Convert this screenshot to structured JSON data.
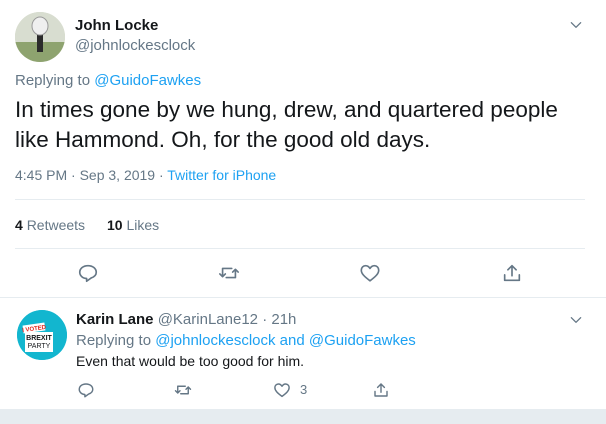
{
  "main_tweet": {
    "author_name": "John Locke",
    "author_handle": "@johnlockesclock",
    "replying_prefix": "Replying to",
    "replying_to": "@GuidoFawkes",
    "text": "In times gone by we hung, drew, and quartered people like Hammond. Oh, for the good old days.",
    "time": "4:45 PM · Sep 3, 2019 ·",
    "source": "Twitter for iPhone",
    "retweets_count": "4",
    "retweets_label": "Retweets",
    "likes_count": "10",
    "likes_label": "Likes"
  },
  "reply_tweet": {
    "author_name": "Karin Lane",
    "author_handle": "@KarinLane12",
    "age": "· 21h",
    "replying_prefix": "Replying to",
    "replying_to_1": "@johnlockesclock",
    "replying_and": "and",
    "replying_to_2": "@GuidoFawkes",
    "text": "Even that would be too good for him.",
    "like_count": "3",
    "avatar_text": {
      "voted": "I VOTED",
      "party_line1": "BREXIT",
      "party_line2": "PARTY"
    }
  },
  "icons": [
    "chevron-down-icon",
    "reply-icon",
    "retweet-icon",
    "like-icon",
    "share-icon"
  ],
  "colors": {
    "accent": "#1da1f2",
    "muted": "#657786",
    "text": "#14171a",
    "icon": "#657786",
    "divider": "#e6ecf0",
    "brexit_teal": "#12b6cf"
  }
}
